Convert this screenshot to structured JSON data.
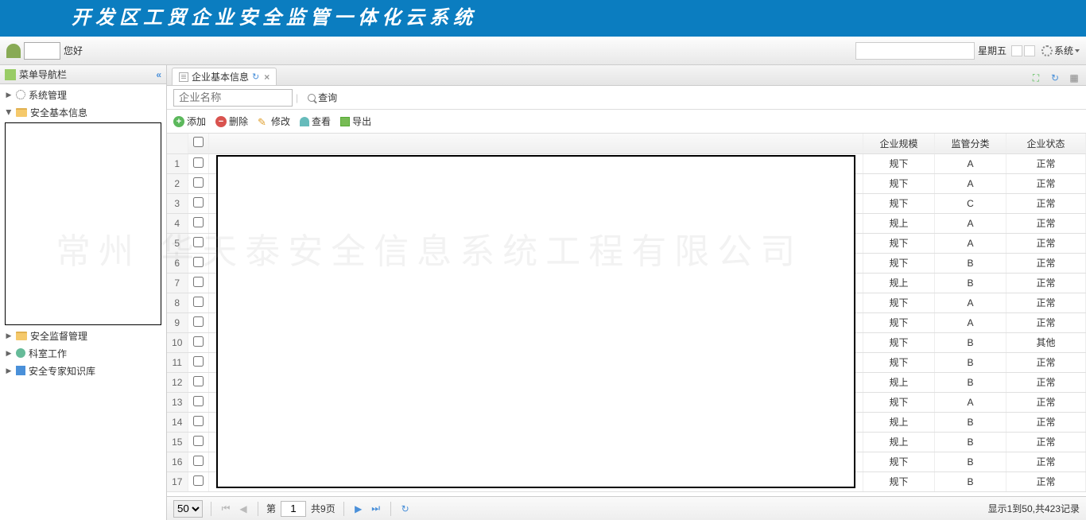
{
  "banner_title": "开发区工贸企业安全监管一体化云系统",
  "topbar": {
    "greeting": "您好",
    "day": "星期五",
    "system_label": "系统"
  },
  "sidebar": {
    "title": "菜单导航栏",
    "items": [
      {
        "label": "系统管理",
        "icon": "gear"
      },
      {
        "label": "安全基本信息",
        "icon": "folder",
        "expanded": true
      },
      {
        "label": "安全监督管理",
        "icon": "folder"
      },
      {
        "label": "科室工作",
        "icon": "people"
      },
      {
        "label": "安全专家知识库",
        "icon": "book"
      }
    ]
  },
  "tab": {
    "label": "企业基本信息"
  },
  "search": {
    "placeholder": "企业名称",
    "btn": "查询"
  },
  "toolbar": {
    "add": "添加",
    "del": "删除",
    "edit": "修改",
    "view": "查看",
    "export": "导出"
  },
  "grid": {
    "headers": {
      "scale": "企业规模",
      "cat": "监管分类",
      "status": "企业状态"
    },
    "rows": [
      {
        "n": 1,
        "scale": "规下",
        "cat": "A",
        "status": "正常"
      },
      {
        "n": 2,
        "scale": "规下",
        "cat": "A",
        "status": "正常"
      },
      {
        "n": 3,
        "scale": "规下",
        "cat": "C",
        "status": "正常"
      },
      {
        "n": 4,
        "scale": "规上",
        "cat": "A",
        "status": "正常"
      },
      {
        "n": 5,
        "scale": "规下",
        "cat": "A",
        "status": "正常"
      },
      {
        "n": 6,
        "scale": "规下",
        "cat": "B",
        "status": "正常"
      },
      {
        "n": 7,
        "scale": "规上",
        "cat": "B",
        "status": "正常"
      },
      {
        "n": 8,
        "scale": "规下",
        "cat": "A",
        "status": "正常"
      },
      {
        "n": 9,
        "scale": "规下",
        "cat": "A",
        "status": "正常"
      },
      {
        "n": 10,
        "scale": "规下",
        "cat": "B",
        "status": "其他"
      },
      {
        "n": 11,
        "scale": "规下",
        "cat": "B",
        "status": "正常"
      },
      {
        "n": 12,
        "scale": "规上",
        "cat": "B",
        "status": "正常"
      },
      {
        "n": 13,
        "scale": "规下",
        "cat": "A",
        "status": "正常"
      },
      {
        "n": 14,
        "scale": "规上",
        "cat": "B",
        "status": "正常"
      },
      {
        "n": 15,
        "scale": "规上",
        "cat": "B",
        "status": "正常"
      },
      {
        "n": 16,
        "scale": "规下",
        "cat": "B",
        "status": "正常"
      },
      {
        "n": 17,
        "scale": "规下",
        "cat": "B",
        "status": "正常"
      }
    ]
  },
  "pager": {
    "size": "50",
    "page_label_prefix": "第",
    "page": "1",
    "total_pages": "共9页",
    "info": "显示1到50,共423记录"
  },
  "watermark": "常州   华天泰安全信息系统工程有限公司"
}
